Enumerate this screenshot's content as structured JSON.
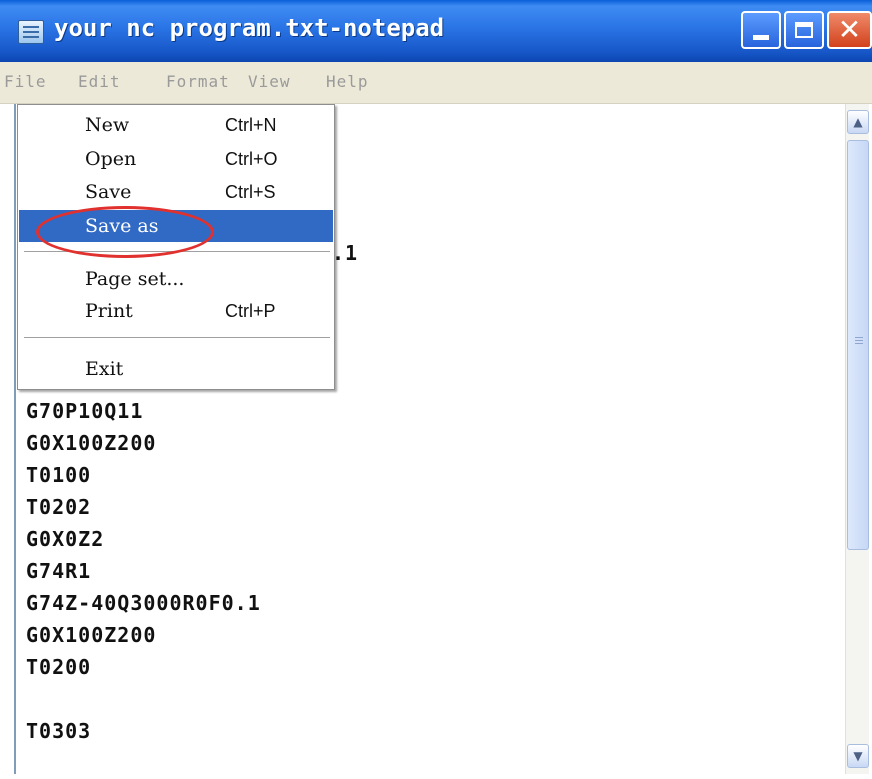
{
  "window": {
    "title": "your nc program.txt-notepad",
    "minimize_icon": "minimize-icon",
    "maximize_icon": "maximize-icon",
    "close_icon": "close-icon",
    "close_glyph": "✕"
  },
  "menubar": {
    "items": [
      "File",
      "Edit",
      "Format",
      "View",
      "Help"
    ]
  },
  "file_menu": {
    "items": [
      {
        "label": "New",
        "shortcut": "Ctrl+N"
      },
      {
        "label": "Open",
        "shortcut": "Ctrl+O"
      },
      {
        "label": "Save",
        "shortcut": "Ctrl+S"
      },
      {
        "label": "Save as",
        "shortcut": "",
        "highlighted": true
      },
      {
        "label": "Page set...",
        "shortcut": ""
      },
      {
        "label": "Print",
        "shortcut": "Ctrl+P"
      },
      {
        "label": "Exit",
        "shortcut": ""
      }
    ]
  },
  "editor": {
    "partial_visible_fragment": ".1",
    "lines": [
      "G70P10Q11",
      "G0X100Z200",
      "T0100",
      "T0202",
      "G0X0Z2",
      "G74R1",
      "G74Z-40Q3000R0F0.1",
      "G0X100Z200",
      "T0200",
      "",
      "T0303"
    ]
  },
  "scrollbar": {
    "up_icon": "▲",
    "down_icon": "▼"
  },
  "colors": {
    "titlebar": "#2a74e6",
    "menu_highlight": "#316ac5",
    "annotation_circle": "#e0312f"
  }
}
